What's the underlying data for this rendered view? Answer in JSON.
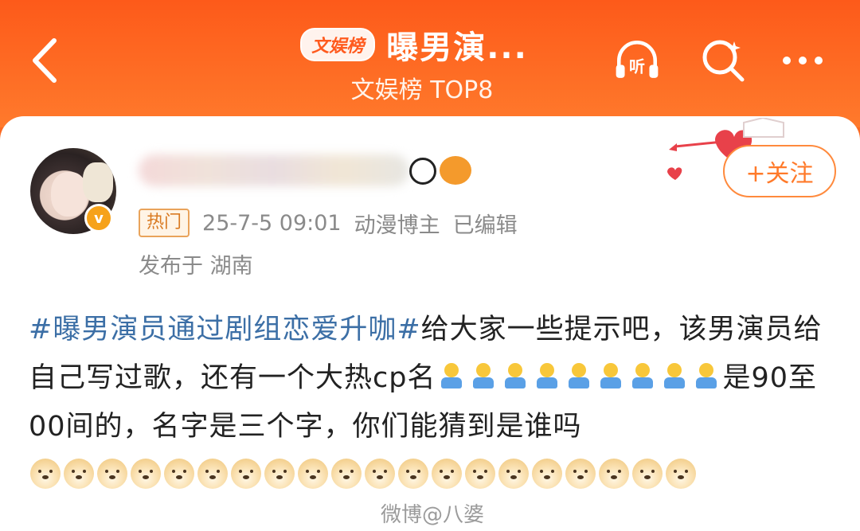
{
  "header": {
    "tag": "文娱榜",
    "title": "曝男演...",
    "subtitle": "文娱榜 TOP8",
    "listen_glyph": "听",
    "more_glyph": "•••",
    "colors": {
      "bg_top": "#fd5a1a",
      "bg_bottom": "#ff7a2c"
    }
  },
  "post": {
    "verified_glyph": "v",
    "follow_label": "+关注",
    "hot_label": "热门",
    "timestamp": "25-7-5 09:01",
    "author_tag": "动漫博主",
    "edited": "已编辑",
    "location": "发布于 湖南",
    "hashtag": "#曝男演员通过剧组恋爱升咖#",
    "text_part1": "给大家一些提示吧，该男演员给自己写过歌，还有一个大热cp名",
    "text_part2": "是90至00间的，名字是三个字，你们能猜到是谁吗",
    "emoji_group1_count": 7,
    "emoji_group2_count": 2,
    "emoji_doge_count": 20
  },
  "watermark": "微博@八婆",
  "colors": {
    "accent": "#ff7a2a",
    "hashtag": "#3c6fa6",
    "text": "#222222",
    "meta": "#8a8a8a"
  }
}
